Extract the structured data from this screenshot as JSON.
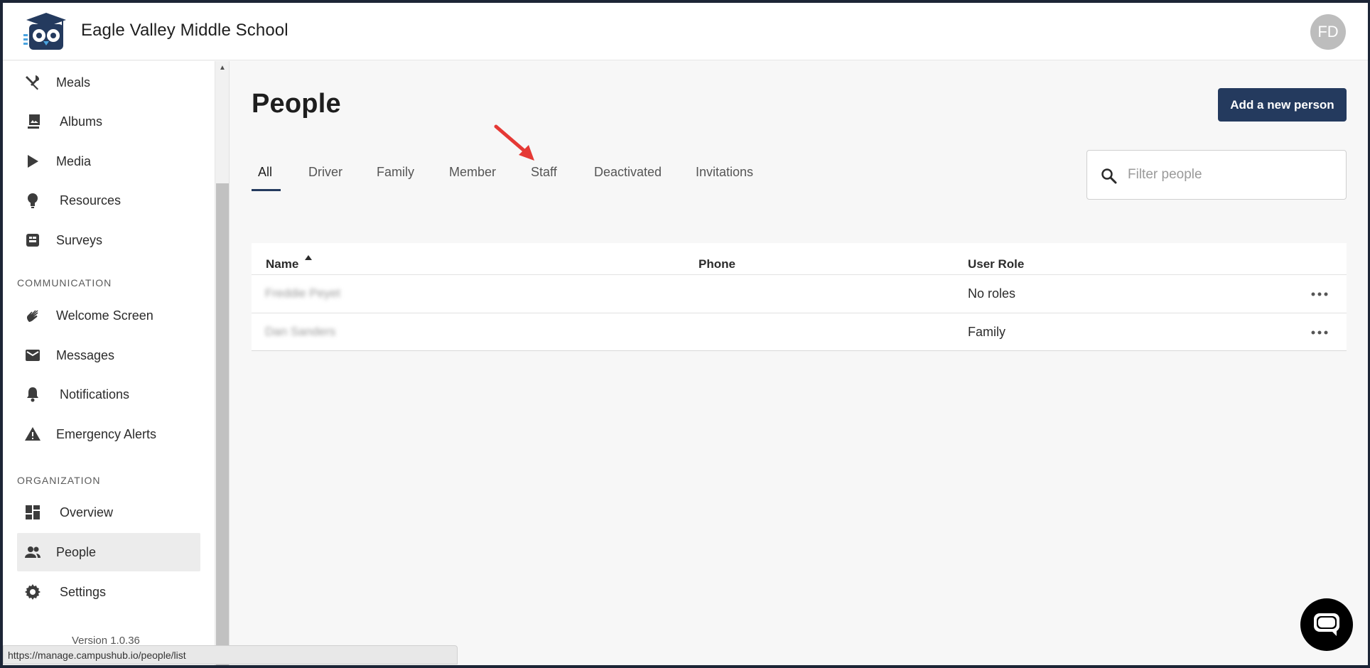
{
  "header": {
    "school_name": "Eagle Valley Middle School",
    "avatar_initials": "FD"
  },
  "sidebar": {
    "items_top": [
      {
        "label": "Meals",
        "icon": "fork-knife-icon"
      },
      {
        "label": "Albums",
        "icon": "photo-library-icon"
      },
      {
        "label": "Media",
        "icon": "play-icon"
      },
      {
        "label": "Resources",
        "icon": "lightbulb-icon"
      },
      {
        "label": "Surveys",
        "icon": "survey-icon"
      }
    ],
    "communication_label": "COMMUNICATION",
    "communication_items": [
      {
        "label": "Welcome Screen",
        "icon": "waving-hand-icon"
      },
      {
        "label": "Messages",
        "icon": "envelope-icon"
      },
      {
        "label": "Notifications",
        "icon": "bell-icon"
      },
      {
        "label": "Emergency Alerts",
        "icon": "warning-icon"
      }
    ],
    "organization_label": "ORGANIZATION",
    "organization_items": [
      {
        "label": "Overview",
        "icon": "dashboard-icon"
      },
      {
        "label": "People",
        "icon": "people-icon",
        "active": true
      },
      {
        "label": "Settings",
        "icon": "gear-icon"
      }
    ],
    "version": "Version 1.0.36"
  },
  "status_url": "https://manage.campushub.io/people/list",
  "main": {
    "title": "People",
    "add_button": "Add a new person",
    "tabs": [
      "All",
      "Driver",
      "Family",
      "Member",
      "Staff",
      "Deactivated",
      "Invitations"
    ],
    "active_tab": "All",
    "search_placeholder": "Filter people",
    "table": {
      "columns": [
        "Name",
        "Phone",
        "User Role"
      ],
      "rows": [
        {
          "name": "Freddie Peyet",
          "phone": "",
          "role": "No roles"
        },
        {
          "name": "Dan Sanders",
          "phone": "",
          "role": "Family"
        }
      ]
    }
  },
  "colors": {
    "primary": "#243a5e",
    "annotation_arrow": "#e53935",
    "active_bg": "#ececec"
  }
}
